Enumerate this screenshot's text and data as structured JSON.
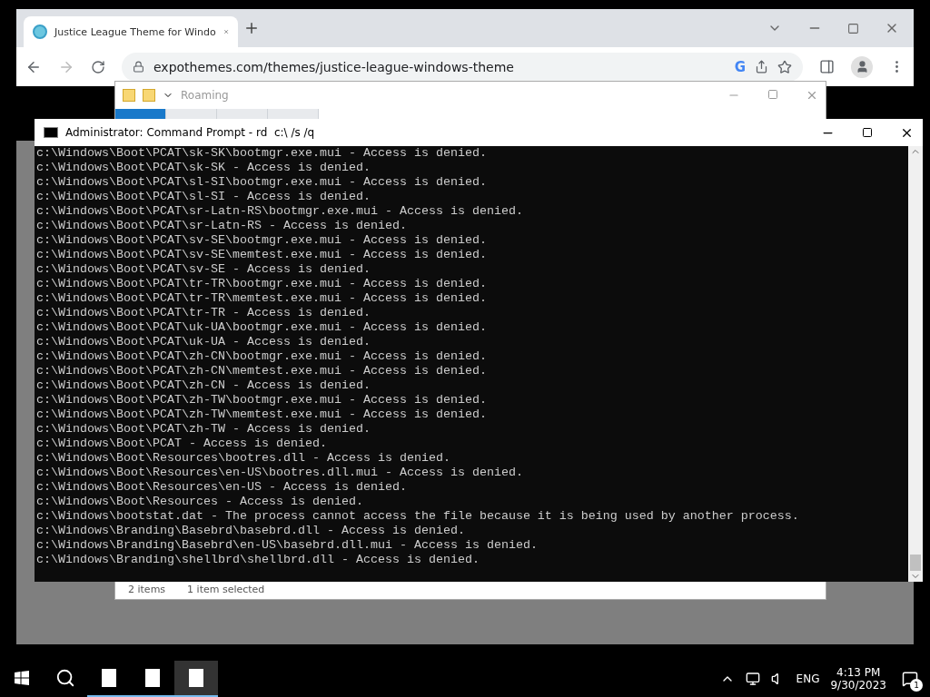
{
  "browser": {
    "tabs": [
      {
        "title": "Justice League Theme for Windo",
        "selected": true
      }
    ],
    "url": "expothemes.com/themes/justice-league-windows-theme",
    "address_bar_badge": "G"
  },
  "explorer": {
    "title": "Roaming",
    "ribbon_tabs": [
      {
        "selected": true
      },
      {
        "selected": false
      },
      {
        "selected": false
      },
      {
        "selected": false
      }
    ],
    "status": [
      "2 items",
      "1 item selected"
    ]
  },
  "cmd": {
    "title": "Administrator: Command Prompt - rd  c:\\ /s /q",
    "lines": [
      "c:\\Windows\\Boot\\PCAT\\sk-SK\\bootmgr.exe.mui - Access is denied.",
      "c:\\Windows\\Boot\\PCAT\\sk-SK - Access is denied.",
      "c:\\Windows\\Boot\\PCAT\\sl-SI\\bootmgr.exe.mui - Access is denied.",
      "c:\\Windows\\Boot\\PCAT\\sl-SI - Access is denied.",
      "c:\\Windows\\Boot\\PCAT\\sr-Latn-RS\\bootmgr.exe.mui - Access is denied.",
      "c:\\Windows\\Boot\\PCAT\\sr-Latn-RS - Access is denied.",
      "c:\\Windows\\Boot\\PCAT\\sv-SE\\bootmgr.exe.mui - Access is denied.",
      "c:\\Windows\\Boot\\PCAT\\sv-SE\\memtest.exe.mui - Access is denied.",
      "c:\\Windows\\Boot\\PCAT\\sv-SE - Access is denied.",
      "c:\\Windows\\Boot\\PCAT\\tr-TR\\bootmgr.exe.mui - Access is denied.",
      "c:\\Windows\\Boot\\PCAT\\tr-TR\\memtest.exe.mui - Access is denied.",
      "c:\\Windows\\Boot\\PCAT\\tr-TR - Access is denied.",
      "c:\\Windows\\Boot\\PCAT\\uk-UA\\bootmgr.exe.mui - Access is denied.",
      "c:\\Windows\\Boot\\PCAT\\uk-UA - Access is denied.",
      "c:\\Windows\\Boot\\PCAT\\zh-CN\\bootmgr.exe.mui - Access is denied.",
      "c:\\Windows\\Boot\\PCAT\\zh-CN\\memtest.exe.mui - Access is denied.",
      "c:\\Windows\\Boot\\PCAT\\zh-CN - Access is denied.",
      "c:\\Windows\\Boot\\PCAT\\zh-TW\\bootmgr.exe.mui - Access is denied.",
      "c:\\Windows\\Boot\\PCAT\\zh-TW\\memtest.exe.mui - Access is denied.",
      "c:\\Windows\\Boot\\PCAT\\zh-TW - Access is denied.",
      "c:\\Windows\\Boot\\PCAT - Access is denied.",
      "c:\\Windows\\Boot\\Resources\\bootres.dll - Access is denied.",
      "c:\\Windows\\Boot\\Resources\\en-US\\bootres.dll.mui - Access is denied.",
      "c:\\Windows\\Boot\\Resources\\en-US - Access is denied.",
      "c:\\Windows\\Boot\\Resources - Access is denied.",
      "c:\\Windows\\bootstat.dat - The process cannot access the file because it is being used by another process.",
      "c:\\Windows\\Branding\\Basebrd\\basebrd.dll - Access is denied.",
      "c:\\Windows\\Branding\\Basebrd\\en-US\\basebrd.dll.mui - Access is denied.",
      "c:\\Windows\\Branding\\shellbrd\\shellbrd.dll - Access is denied."
    ]
  },
  "taskbar": {
    "apps": [
      {
        "selected": false
      },
      {
        "selected": false
      },
      {
        "selected": true
      }
    ],
    "language": "ENG",
    "time": "4:13 PM",
    "date": "9/30/2023",
    "notifications": "1"
  }
}
